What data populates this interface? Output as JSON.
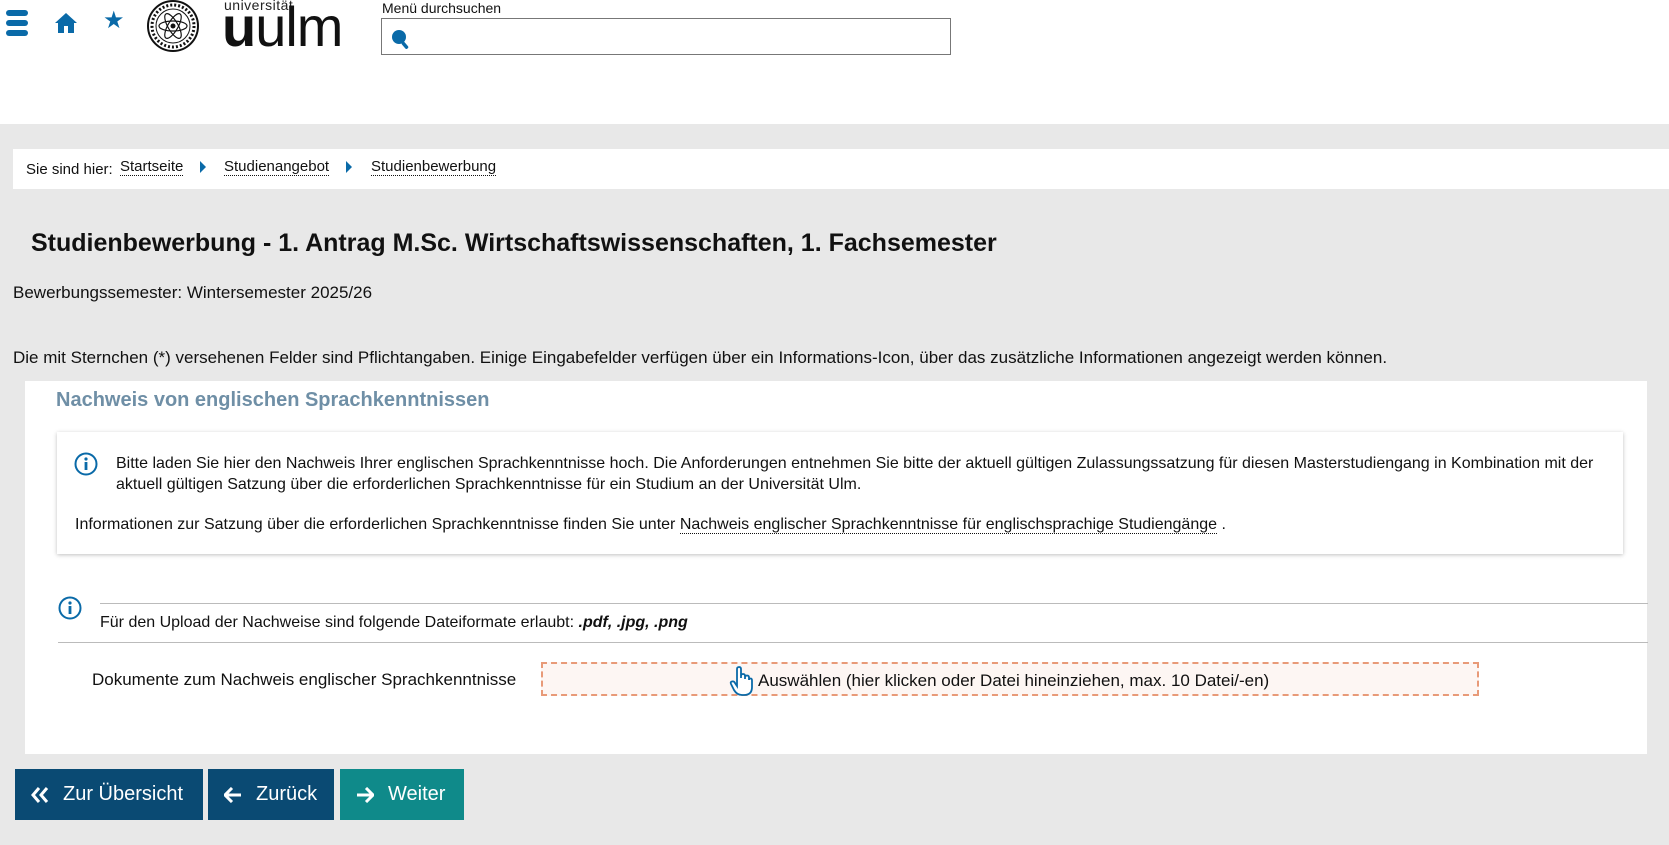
{
  "header": {
    "logo_small": "universität",
    "logo_u": "u",
    "logo_rest": "ulm",
    "search_label": "Menü durchsuchen",
    "search_value": "",
    "icons": [
      "menu-icon",
      "home-icon",
      "star-icon",
      "search-icon"
    ],
    "accent_color": "#0a6aa8"
  },
  "breadcrumb": {
    "prefix": "Sie sind hier:",
    "items": [
      "Startseite",
      "Studienangebot",
      "Studienbewerbung"
    ]
  },
  "page": {
    "title": "Studienbewerbung - 1. Antrag M.Sc. Wirtschaftswissenschaften, 1. Fachsemester",
    "semester": "Bewerbungssemester: Wintersemester 2025/26",
    "required_note": "Die mit Sternchen (*) versehenen Felder sind Pflichtangaben. Einige Eingabefelder verfügen über ein Informations-Icon, über das zusätzliche Informationen angezeigt werden können."
  },
  "panel": {
    "title": "Nachweis von englischen Sprachkenntnissen",
    "info_text": "Bitte laden Sie hier den Nachweis Ihrer englischen Sprachkenntnisse hoch. Die Anforderungen entnehmen Sie bitte der aktuell gültigen Zulassungssatzung für diesen Masterstudiengang in Kombination mit der aktuell gültigen Satzung über die erforderlichen Sprachkenntnisse für ein Studium an der Universität Ulm.",
    "info_text2_prefix": "Informationen zur Satzung über die erforderlichen Sprachkenntnisse finden Sie unter",
    "info_link": "Nachweis englischer Sprachkenntnisse für englischsprachige Studiengänge",
    "info_text2_suffix": ".",
    "formats_prefix": "Für den Upload der Nachweise sind folgende Dateiformate erlaubt:",
    "formats": ".pdf, .jpg, .png",
    "doc_label": "Dokumente zum Nachweis englischer Sprachkenntnisse",
    "dropzone_text": "Auswählen (hier klicken oder Datei hineinziehen, max. 10 Datei/-en)"
  },
  "buttons": {
    "overview": "Zur Übersicht",
    "back": "Zurück",
    "next": "Weiter",
    "primary_color": "#0a4a73",
    "next_color": "#0f8a8a"
  }
}
